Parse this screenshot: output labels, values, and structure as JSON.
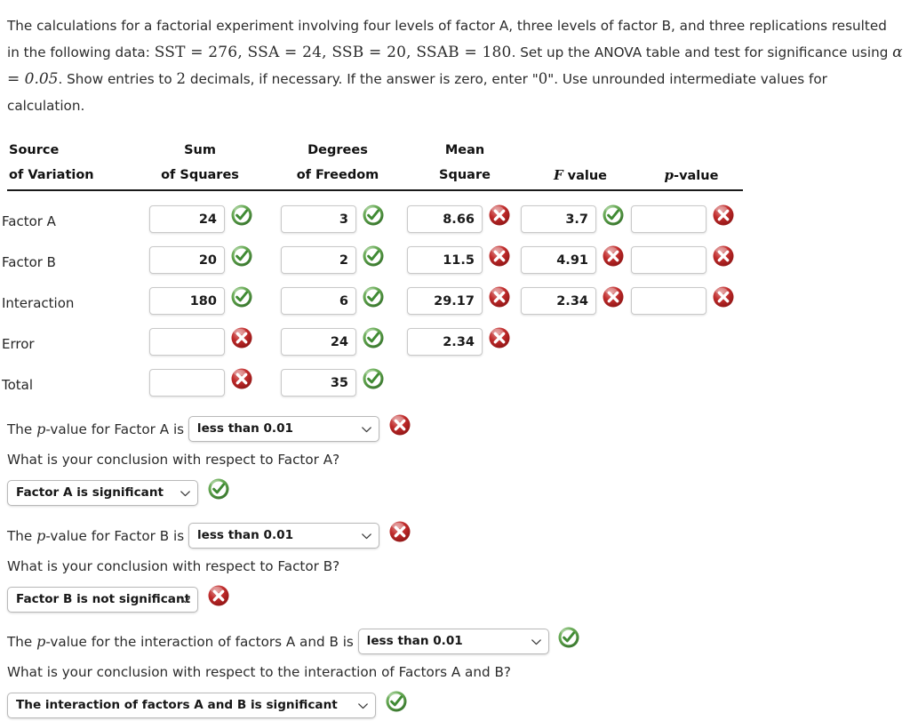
{
  "prompt": {
    "seg1": "The calculations for a factorial experiment involving four levels of factor A, three levels of factor B, and three replications resulted in the following data: ",
    "sst": "SST = 276,",
    "ssa": "SSA = 24,",
    "ssb": "SSB = 20,",
    "ssab": "SSAB = 180",
    "seg2": ". Set up the ANOVA table and test for significance using ",
    "alpha": "α = 0.05",
    "seg3": ". Show entries to ",
    "two": "2",
    "seg4": " decimals, if necessary. If the answer is zero, enter \"",
    "zero": "0",
    "seg5": "\". Use unrounded intermediate values for calculation."
  },
  "table": {
    "headers": [
      {
        "l1": "Source",
        "l2": "of Variation"
      },
      {
        "l1": "Sum",
        "l2": "of Squares"
      },
      {
        "l1": "Degrees",
        "l2": "of Freedom"
      },
      {
        "l1": "Mean",
        "l2": "Square"
      },
      {
        "l1": "",
        "l2": "F value"
      },
      {
        "l1": "",
        "l2": "p-value"
      }
    ],
    "rows": [
      {
        "label": "Factor A",
        "cells": [
          {
            "value": "24",
            "mark": "check"
          },
          {
            "value": "3",
            "mark": "check"
          },
          {
            "value": "8.66",
            "mark": "cross"
          },
          {
            "value": "3.7",
            "mark": "check"
          },
          {
            "value": "",
            "mark": "cross"
          }
        ]
      },
      {
        "label": "Factor B",
        "cells": [
          {
            "value": "20",
            "mark": "check"
          },
          {
            "value": "2",
            "mark": "check"
          },
          {
            "value": "11.5",
            "mark": "cross"
          },
          {
            "value": "4.91",
            "mark": "cross"
          },
          {
            "value": "",
            "mark": "cross"
          }
        ]
      },
      {
        "label": "Interaction",
        "cells": [
          {
            "value": "180",
            "mark": "check"
          },
          {
            "value": "6",
            "mark": "check"
          },
          {
            "value": "29.17",
            "mark": "cross"
          },
          {
            "value": "2.34",
            "mark": "cross"
          },
          {
            "value": "",
            "mark": "cross"
          }
        ]
      },
      {
        "label": "Error",
        "cells": [
          {
            "value": "",
            "mark": "cross"
          },
          {
            "value": "24",
            "mark": "check"
          },
          {
            "value": "2.34",
            "mark": "cross"
          }
        ]
      },
      {
        "label": "Total",
        "cells": [
          {
            "value": "",
            "mark": "cross"
          },
          {
            "value": "35",
            "mark": "check"
          }
        ]
      }
    ]
  },
  "questions": [
    {
      "pre": "The ",
      "ital": "p",
      "post": "-value for Factor A is",
      "select_value": "less than 0.01",
      "select_mark": "cross",
      "question": "What is your conclusion with respect to Factor A?",
      "answer_value": "Factor A is significant",
      "answer_mark": "check"
    },
    {
      "pre": "The ",
      "ital": "p",
      "post": "-value for Factor B is",
      "select_value": "less than 0.01",
      "select_mark": "cross",
      "question": "What is your conclusion with respect to Factor B?",
      "answer_value": "Factor B is not significant",
      "answer_mark": "cross"
    },
    {
      "pre": "The ",
      "ital": "p",
      "post": "-value for the interaction of factors A and B is",
      "select_value": "less than 0.01",
      "select_mark": "check",
      "question": "What is your conclusion with respect to the interaction of Factors A and B?",
      "answer_value": "The interaction of factors A and B is significant",
      "answer_mark": "check"
    }
  ],
  "colors": {
    "check_green": "#3f8a33",
    "cross_red": "#a81d1d",
    "text": "#2b2b2b"
  }
}
